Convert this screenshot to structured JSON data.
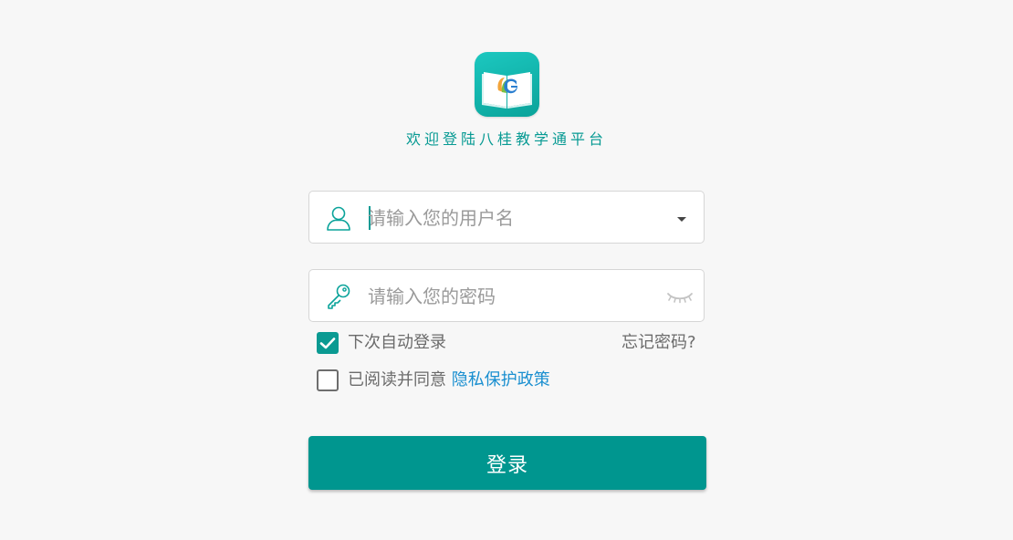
{
  "app": {
    "welcome_text": "欢迎登陆八桂教学通平台",
    "logo_icon": "book-logo-icon"
  },
  "username": {
    "placeholder": "请输入您的用户名",
    "value": "",
    "icon": "user-icon",
    "dropdown_icon": "caret-down-icon"
  },
  "password": {
    "placeholder": "请输入您的密码",
    "value": "",
    "icon": "key-icon",
    "visibility_icon": "eye-closed-icon"
  },
  "options": {
    "auto_login_label": "下次自动登录",
    "auto_login_checked": true,
    "forgot_password": "忘记密码?",
    "agree_prefix": "已阅读并同意",
    "privacy_link": "隐私保护政策",
    "agree_checked": false
  },
  "login": {
    "button_label": "登录"
  },
  "colors": {
    "primary": "#00968f",
    "link": "#1a8fd0",
    "background": "#f7f7f7"
  }
}
